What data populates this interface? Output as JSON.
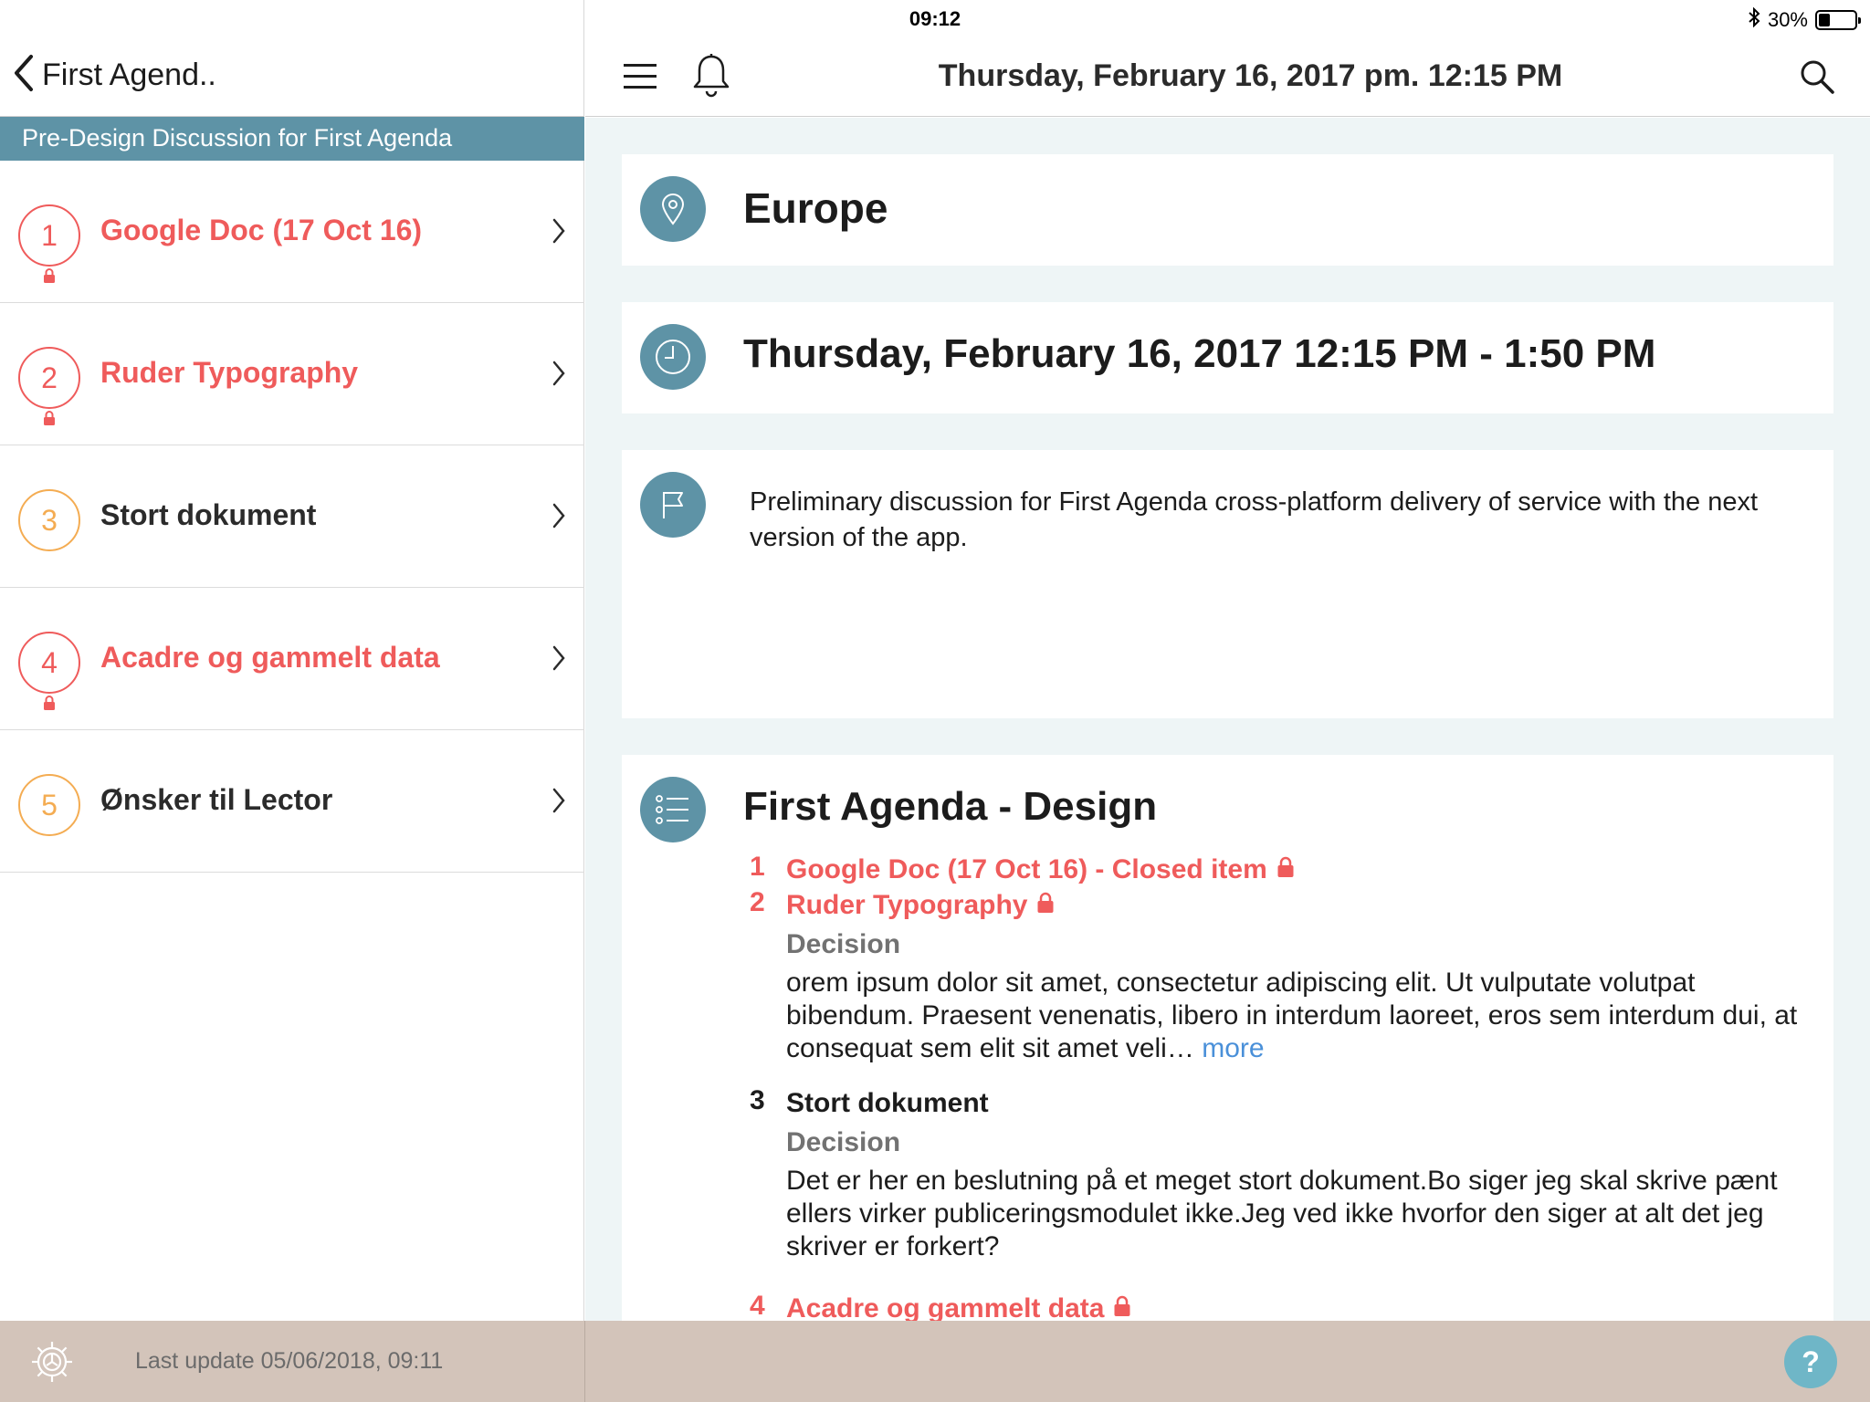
{
  "status_bar": {
    "device": "iPad",
    "time": "09:12",
    "battery": "30%"
  },
  "left_nav": {
    "back_label": "First Agend.."
  },
  "meeting_banner": "Pre-Design Discussion for First Agenda",
  "agenda_list": [
    {
      "number": "1",
      "title": "Google Doc (17 Oct 16)",
      "locked": true
    },
    {
      "number": "2",
      "title": "Ruder Typography",
      "locked": true
    },
    {
      "number": "3",
      "title": "Stort dokument",
      "locked": false
    },
    {
      "number": "4",
      "title": "Acadre og gammelt data",
      "locked": true
    },
    {
      "number": "5",
      "title": "Ønsker til Lector",
      "locked": false
    }
  ],
  "right_nav": {
    "title": "Thursday, February 16, 2017 pm. 12:15 PM"
  },
  "meeting": {
    "location": "Europe",
    "time_range": "Thursday, February 16, 2017 12:15 PM - 1:50 PM",
    "description": "Preliminary discussion for First Agenda cross-platform delivery of service with the next version of the app."
  },
  "agenda_detail": {
    "title": "First Agenda - Design",
    "items": [
      {
        "number": "1",
        "title": "Google Doc (17 Oct 16) - Closed item",
        "locked": true
      },
      {
        "number": "2",
        "title": "Ruder Typography",
        "locked": true,
        "decision_label": "Decision",
        "decision_text": "orem ipsum dolor sit amet, consectetur adipiscing elit. Ut vulputate volutpat bibendum. Praesent venenatis, libero in interdum laoreet, eros sem interdum dui, at consequat sem elit sit amet veli…",
        "more_label": "more"
      },
      {
        "number": "3",
        "title": "Stort dokument",
        "locked": false,
        "decision_label": "Decision",
        "decision_text": "Det er her en beslutning på et meget stort dokument.Bo siger jeg skal skrive pænt ellers virker publiceringsmodulet ikke.Jeg ved ikke hvorfor den siger at alt det jeg skriver er forkert?"
      },
      {
        "number": "4",
        "title": "Acadre og gammelt data",
        "locked": true
      }
    ]
  },
  "footer": {
    "last_update": "Last update 05/06/2018, 09:11",
    "help_label": "?"
  },
  "colors": {
    "accent_teal": "#5e93a6",
    "item_red": "#ef5b5b",
    "item_orange": "#f4ac52",
    "footer_bg": "#d3c4ba",
    "link_blue": "#4a90d9"
  },
  "icons": [
    "wifi-icon",
    "bluetooth-icon",
    "battery-icon",
    "back-chevron-icon",
    "lock-icon",
    "chevron-right-icon",
    "menu-icon",
    "bell-icon",
    "search-icon",
    "location-pin-icon",
    "clock-icon",
    "flag-icon",
    "list-icon",
    "settings-gear-icon",
    "help-icon"
  ]
}
